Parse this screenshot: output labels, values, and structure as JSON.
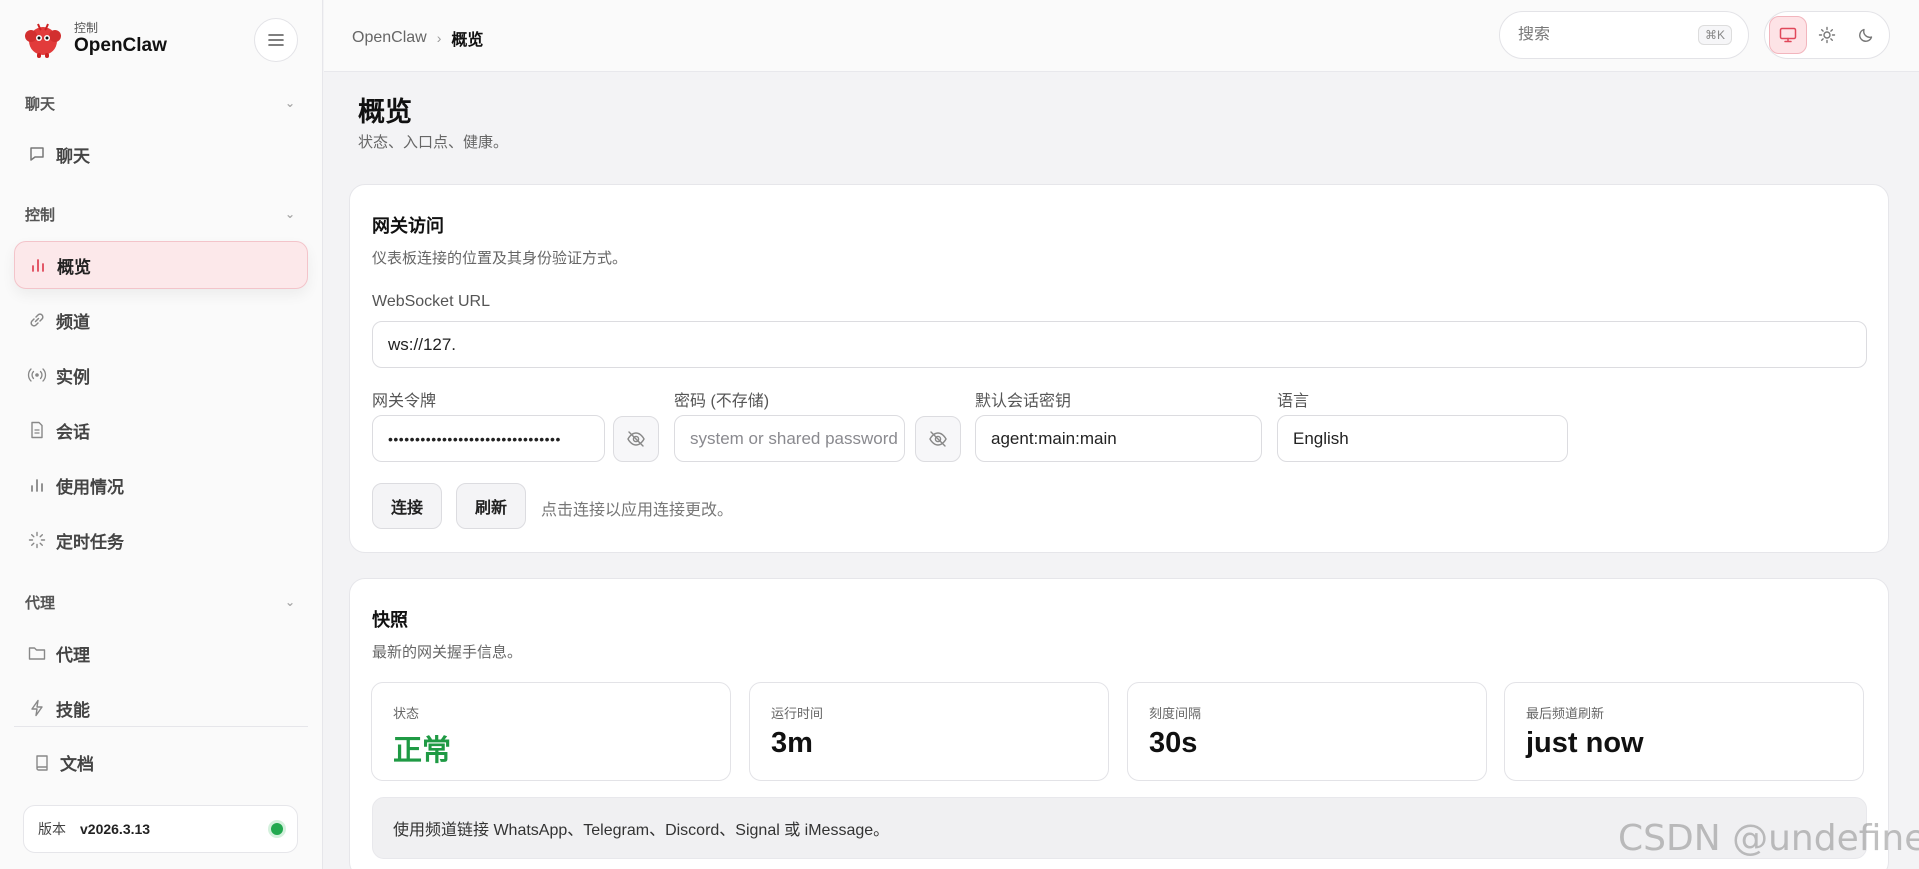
{
  "brand": {
    "sub": "控制",
    "name": "OpenClaw"
  },
  "sidebar": {
    "sections": [
      {
        "label": "聊天",
        "items": [
          {
            "label": "聊天",
            "icon": "chat-icon"
          }
        ]
      },
      {
        "label": "控制",
        "items": [
          {
            "label": "概览",
            "icon": "bar-chart-icon",
            "active": true
          },
          {
            "label": "频道",
            "icon": "link-icon"
          },
          {
            "label": "实例",
            "icon": "broadcast-icon"
          },
          {
            "label": "会话",
            "icon": "document-icon"
          },
          {
            "label": "使用情况",
            "icon": "bar-chart-icon"
          },
          {
            "label": "定时任务",
            "icon": "loader-icon"
          }
        ]
      },
      {
        "label": "代理",
        "items": [
          {
            "label": "代理",
            "icon": "folder-icon"
          },
          {
            "label": "技能",
            "icon": "lightning-icon"
          }
        ]
      }
    ],
    "docs": "文档",
    "version_label": "版本",
    "version_value": "v2026.3.13",
    "status_color": "#22a94f"
  },
  "topbar": {
    "breadcrumb_root": "OpenClaw",
    "breadcrumb_current": "概览",
    "search_placeholder": "搜索",
    "search_shortcut": "⌘K",
    "theme_modes": [
      "system",
      "light",
      "dark"
    ],
    "theme_selected": "system"
  },
  "page": {
    "title": "概览",
    "subtitle": "状态、入口点、健康。"
  },
  "gateway": {
    "title": "网关访问",
    "subtitle": "仪表板连接的位置及其身份验证方式。",
    "ws_label": "WebSocket URL",
    "ws_value": "ws://127.",
    "token_label": "网关令牌",
    "token_value": "••••••••••••••••••••••••••••••••",
    "password_label": "密码 (不存储)",
    "password_placeholder": "system or shared password",
    "session_label": "默认会话密钥",
    "session_value": "agent:main:main",
    "language_label": "语言",
    "language_value": "English",
    "connect_label": "连接",
    "refresh_label": "刷新",
    "hint": "点击连接以应用连接更改。"
  },
  "snapshot": {
    "title": "快照",
    "subtitle": "最新的网关握手信息。",
    "stats": [
      {
        "label": "状态",
        "value": "正常",
        "ok": true
      },
      {
        "label": "运行时间",
        "value": "3m"
      },
      {
        "label": "刻度间隔",
        "value": "30s"
      },
      {
        "label": "最后频道刷新",
        "value": "just now"
      }
    ],
    "notice": "使用频道链接 WhatsApp、Telegram、Discord、Signal 或 iMessage。"
  },
  "colors": {
    "accent": "#e0485a",
    "ok": "#1f9a44"
  },
  "watermark": "CSDN @undefined"
}
